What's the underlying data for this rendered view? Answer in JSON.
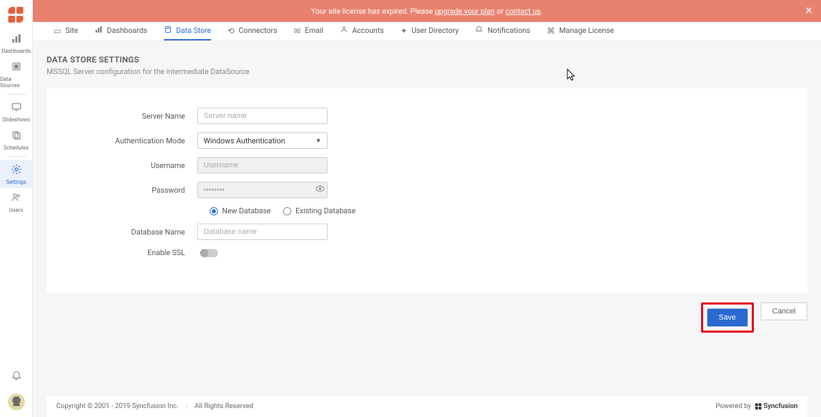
{
  "banner": {
    "text_before": "Your site license has expired. Please ",
    "link_upgrade": "upgrade your plan",
    "text_or": " or ",
    "link_contact": "contact us",
    "text_after": "."
  },
  "sidebar": {
    "items": [
      {
        "label": "Dashboards",
        "icon": "bars-icon"
      },
      {
        "label": "Data Sources",
        "icon": "datasource-icon"
      },
      {
        "label": "Slideshows",
        "icon": "monitor-icon"
      },
      {
        "label": "Schedules",
        "icon": "copy-icon"
      },
      {
        "label": "Settings",
        "icon": "gear-icon"
      },
      {
        "label": "Users",
        "icon": "users-icon"
      }
    ]
  },
  "tabs": [
    {
      "label": "Site",
      "icon": "site-icon"
    },
    {
      "label": "Dashboards",
      "icon": "bars-icon"
    },
    {
      "label": "Data Store",
      "icon": "datastore-icon"
    },
    {
      "label": "Connectors",
      "icon": "link-icon"
    },
    {
      "label": "Email",
      "icon": "mail-icon"
    },
    {
      "label": "Accounts",
      "icon": "account-icon"
    },
    {
      "label": "User Directory",
      "icon": "directory-icon"
    },
    {
      "label": "Notifications",
      "icon": "bell-icon"
    },
    {
      "label": "Manage License",
      "icon": "license-icon"
    }
  ],
  "page": {
    "title": "DATA STORE SETTINGS",
    "subtitle": "MSSQL Server configuration for the intermediate DataSource"
  },
  "form": {
    "server_name": {
      "label": "Server Name",
      "placeholder": "Server name",
      "value": ""
    },
    "auth_mode": {
      "label": "Authentication Mode",
      "value": "Windows Authentication"
    },
    "username": {
      "label": "Username",
      "placeholder": "Username",
      "value": ""
    },
    "password": {
      "label": "Password",
      "value": "••••••••"
    },
    "db_choice": {
      "new": "New Database",
      "existing": "Existing Database",
      "selected": "new"
    },
    "database_name": {
      "label": "Database Name",
      "placeholder": "Database name",
      "value": ""
    },
    "enable_ssl": {
      "label": "Enable SSL",
      "value": false
    }
  },
  "actions": {
    "save": "Save",
    "cancel": "Cancel"
  },
  "footer": {
    "copyright": "Copyright © 2001 - 2019 Syncfusion Inc.",
    "rights": "All Rights Reserved",
    "powered": "Powered by",
    "brand": "Syncfusion"
  }
}
